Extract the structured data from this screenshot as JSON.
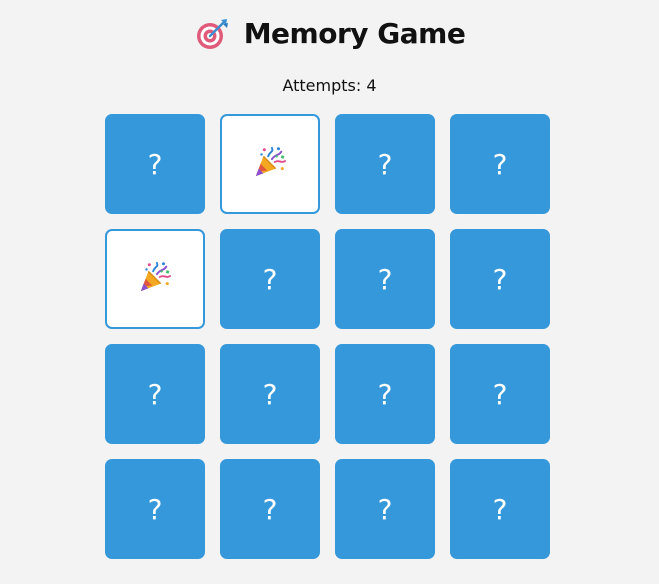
{
  "header": {
    "title": "Memory Game",
    "icon": "dart-target-icon"
  },
  "status": {
    "attempts_text": "Attempts: 4"
  },
  "colors": {
    "card_back": "#3598db",
    "background": "#f3f3f3",
    "revealed_border": "#3598db"
  },
  "board": {
    "rows": 4,
    "cols": 4,
    "cards": [
      {
        "state": "hidden",
        "label": "?"
      },
      {
        "state": "revealed",
        "icon": "party-popper-icon"
      },
      {
        "state": "hidden",
        "label": "?"
      },
      {
        "state": "hidden",
        "label": "?"
      },
      {
        "state": "revealed",
        "icon": "party-popper-icon"
      },
      {
        "state": "hidden",
        "label": "?"
      },
      {
        "state": "hidden",
        "label": "?"
      },
      {
        "state": "hidden",
        "label": "?"
      },
      {
        "state": "hidden",
        "label": "?"
      },
      {
        "state": "hidden",
        "label": "?"
      },
      {
        "state": "hidden",
        "label": "?"
      },
      {
        "state": "hidden",
        "label": "?"
      },
      {
        "state": "hidden",
        "label": "?"
      },
      {
        "state": "hidden",
        "label": "?"
      },
      {
        "state": "hidden",
        "label": "?"
      },
      {
        "state": "hidden",
        "label": "?"
      }
    ]
  }
}
